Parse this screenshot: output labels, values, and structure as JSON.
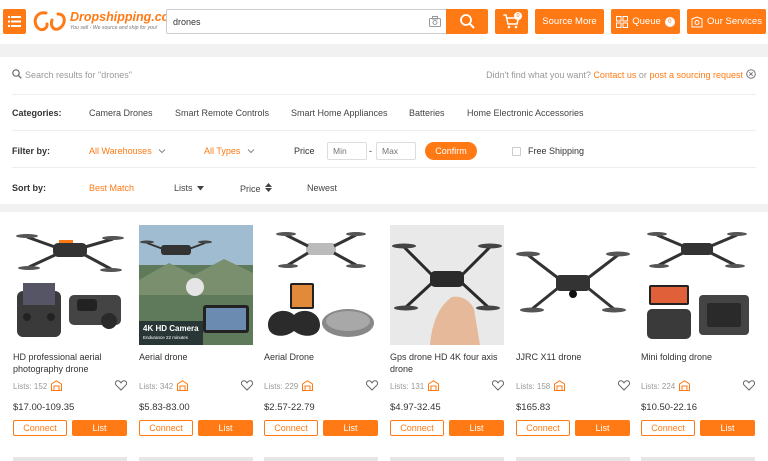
{
  "header": {
    "logo_name": "Dropshipping.com",
    "logo_tagline": "You sell - We source and ship for you!",
    "search_value": "drones",
    "cart_count": "0",
    "source_more_label": "Source More",
    "queue_label": "Queue",
    "queue_count": "0",
    "our_services_label": "Our Services"
  },
  "filters": {
    "results_placeholder": "Search results for \"drones\"",
    "not_found_text": "Didn't find what you want?",
    "contact_us": "Contact us",
    "or_text": "or",
    "post_request": "post a sourcing request",
    "categories_label": "Categories:",
    "categories": [
      "Camera Drones",
      "Smart Remote Controls",
      "Smart Home Appliances",
      "Batteries",
      "Home Electronic Accessories"
    ],
    "filter_by_label": "Filter by:",
    "warehouse": "All Warehouses",
    "types": "All Types",
    "price_label": "Price",
    "min_placeholder": "Min",
    "max_placeholder": "Max",
    "confirm_label": "Confirm",
    "free_shipping": "Free Shipping",
    "sort_by_label": "Sort by:",
    "sort_options": [
      "Best Match",
      "Lists",
      "Price",
      "Newest"
    ]
  },
  "products": [
    {
      "title": "HD professional aerial photography drone",
      "lists": "Lists: 152",
      "price": "$17.00-109.35"
    },
    {
      "title": "Aerial drone",
      "lists": "Lists: 342",
      "price": "$5.83-83.00",
      "img_text": "4K HD Camera",
      "img_subtext": "Endurance 22 minutes"
    },
    {
      "title": "Aerial Drone",
      "lists": "Lists: 229",
      "price": "$2.57-22.79"
    },
    {
      "title": "Gps drone HD 4K four axis drone",
      "lists": "Lists: 131",
      "price": "$4.97-32.45"
    },
    {
      "title": "JJRC X11 drone",
      "lists": "Lists: 158",
      "price": "$165.83"
    },
    {
      "title": "Mini folding drone",
      "lists": "Lists: 224",
      "price": "$10.50-22.16"
    }
  ],
  "card_buttons": {
    "connect": "Connect",
    "list": "List"
  },
  "colors": {
    "accent": "#ff7a14",
    "background": "#f1f1f1"
  }
}
